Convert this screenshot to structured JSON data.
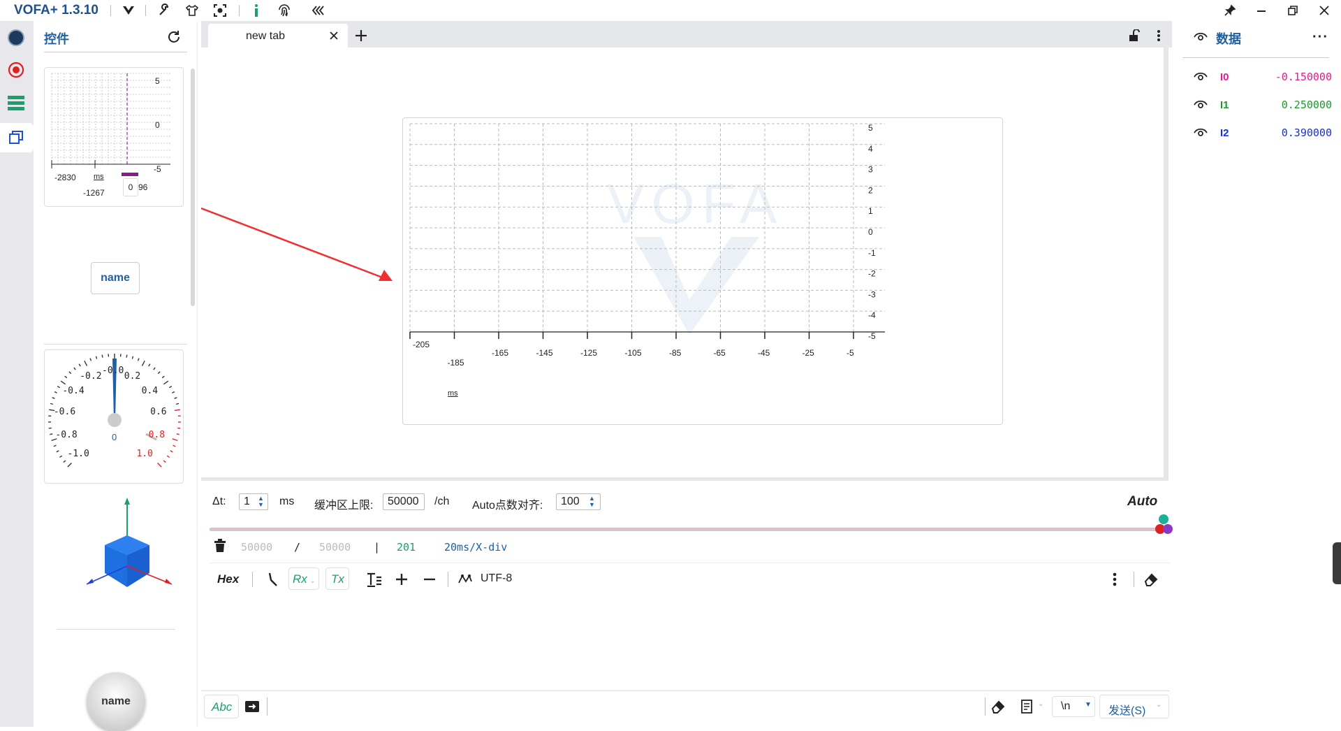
{
  "app": {
    "title": "VOFA+ 1.3.10"
  },
  "left_panel": {
    "title": "控件",
    "name_button": "name",
    "knob_label": "name"
  },
  "mini_chart": {
    "y_ticks": [
      "5",
      "0",
      "-5"
    ],
    "x_tick_1": "-2830",
    "x_unit": "ms",
    "x_tick_2": "-1267",
    "tooltip_value": "0",
    "tooltip_tail": "96"
  },
  "gauge": {
    "labels": [
      "-1.0",
      "-0.8",
      "-0.6",
      "-0.4",
      "-0.2",
      "-0.0",
      "0.2",
      "0.4",
      "0.6",
      "0.8",
      "1.0"
    ],
    "value": "0"
  },
  "tab": {
    "label": "new tab"
  },
  "chart_data": {
    "type": "line",
    "y_ticks": [
      "5",
      "4",
      "3",
      "2",
      "1",
      "0",
      "-1",
      "-2",
      "-3",
      "-4",
      "-5"
    ],
    "x_ticks": [
      "-205",
      "-185",
      "-165",
      "-145",
      "-125",
      "-105",
      "-85",
      "-65",
      "-45",
      "-25",
      "-5"
    ],
    "x_unit": "ms",
    "ylim": [
      -5,
      5
    ],
    "xlim": [
      -205,
      -5
    ],
    "grid": true,
    "watermark": "VOFA",
    "series": []
  },
  "controls": {
    "dt_label": "Δt:",
    "dt_value": "1",
    "dt_unit": "ms",
    "buffer_label": "缓冲区上限:",
    "buffer_value": "50000",
    "buffer_unit": "/ch",
    "auto_label": "Auto点数对齐:",
    "auto_value": "100",
    "auto_button": "Auto"
  },
  "status": {
    "count_a": "50000",
    "slash": "/",
    "count_b": "50000",
    "bar": "|",
    "points": "201",
    "div": "20ms/X-div"
  },
  "rx_toolbar": {
    "hex": "Hex",
    "rx": "Rx",
    "tx": "Tx",
    "encoding": "UTF-8"
  },
  "send_bar": {
    "abc": "Abc",
    "newline": "\\n",
    "send": "发送(S)"
  },
  "right_panel": {
    "title": "数据",
    "channels": [
      {
        "name": "I0",
        "value": "-0.150000",
        "color": "#e8198c"
      },
      {
        "name": "I1",
        "value": "0.250000",
        "color": "#1a9a2a"
      },
      {
        "name": "I2",
        "value": "0.390000",
        "color": "#1a2fd6"
      }
    ]
  }
}
